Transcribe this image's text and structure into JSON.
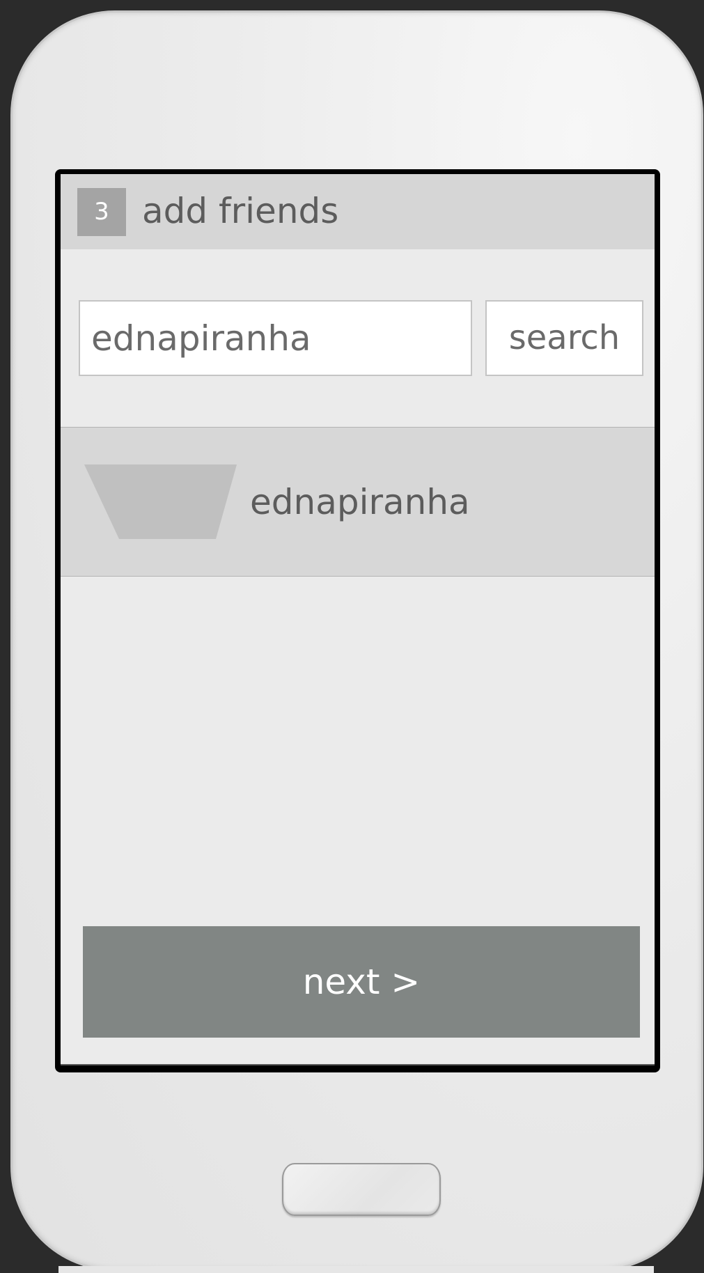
{
  "header": {
    "step_badge": "3",
    "title": "add friends"
  },
  "search": {
    "value": "ednapiranha",
    "button_label": "search"
  },
  "results": [
    {
      "name": "ednapiranha",
      "avatar_icon": "avatar-placeholder-icon"
    }
  ],
  "footer": {
    "next_label": "next >"
  },
  "colors": {
    "header_bg": "#d6d6d6",
    "screen_bg": "#ebebeb",
    "result_bg": "#d7d7d7",
    "next_button_bg": "#818684",
    "badge_bg": "#a4a4a4"
  }
}
